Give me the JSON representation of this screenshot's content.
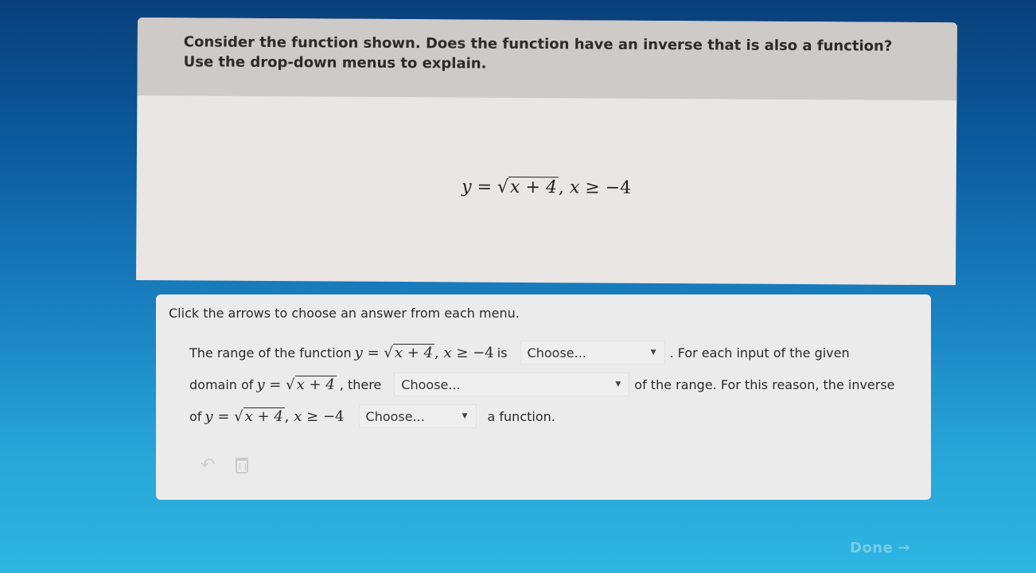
{
  "prompt": {
    "text": "Consider the function shown. Does the function have an inverse that is also a function? Use the drop-down menus to explain."
  },
  "equation": {
    "y": "y",
    "eq": "=",
    "radicand": "x + 4",
    "comma": ",",
    "x": "x",
    "geq": "≥",
    "bound": "−4"
  },
  "answer": {
    "instructions": "Click the arrows to choose an answer from each menu.",
    "line1": {
      "pre": "The range of the function",
      "mid": "is",
      "post": ". For each input of the given"
    },
    "line2": {
      "pre": "domain of",
      "mid": ", there",
      "post": "of the range. For this reason, the inverse"
    },
    "line3": {
      "pre": "of",
      "post": "a function."
    },
    "dropdowns": [
      {
        "selected": "Choose..."
      },
      {
        "selected": "Choose..."
      },
      {
        "selected": "Choose..."
      }
    ]
  },
  "icons": {
    "undo": "undo-icon",
    "trash": "trash-icon",
    "caret": "caret-down-icon",
    "arrow": "arrow-right-icon"
  },
  "footer": {
    "done_label": "Done",
    "done_arrow": "→"
  }
}
